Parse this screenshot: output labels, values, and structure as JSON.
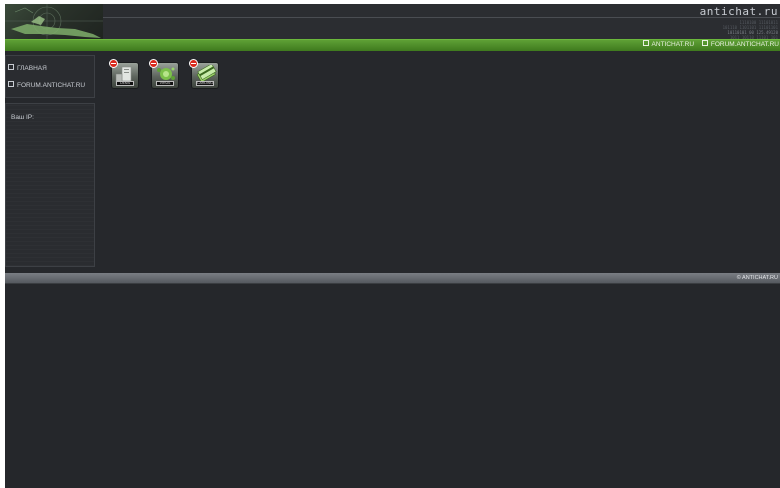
{
  "header": {
    "brand": "antichat.ru",
    "hex_lines": [
      "1110100 11101011",
      "101110 1101101 11101101",
      "10110101 00 125.49120",
      "1011 10110 11101 101"
    ]
  },
  "top_nav": {
    "links": [
      {
        "label": "ANTICHAT.RU",
        "icon": "square-bullet-icon"
      },
      {
        "label": "FORUM.ANTICHAT.RU",
        "icon": "square-bullet-icon"
      }
    ]
  },
  "sidebar": {
    "items": [
      {
        "label": "ГЛАВНАЯ",
        "icon": "square-bullet-icon"
      },
      {
        "label": "FORUM.ANTICHAT.RU",
        "icon": "square-bullet-icon"
      }
    ],
    "ip_label": "Ваш IP:",
    "ip_value": ""
  },
  "categories": [
    {
      "tag": "OEMS",
      "icon": "server-icon",
      "badge": "stop-badge-icon"
    },
    {
      "tag": "VIRUS",
      "icon": "virus-icon",
      "badge": "stop-badge-icon"
    },
    {
      "tag": "CARDING",
      "icon": "cards-icon",
      "badge": "stop-badge-icon"
    }
  ],
  "footer": {
    "copyright": "© ANTICHAT.RU"
  },
  "colors": {
    "background": "#26282c",
    "nav_green": "#4f8f2a",
    "footer_gray": "#6a6e74",
    "text": "#c8ccd2"
  }
}
